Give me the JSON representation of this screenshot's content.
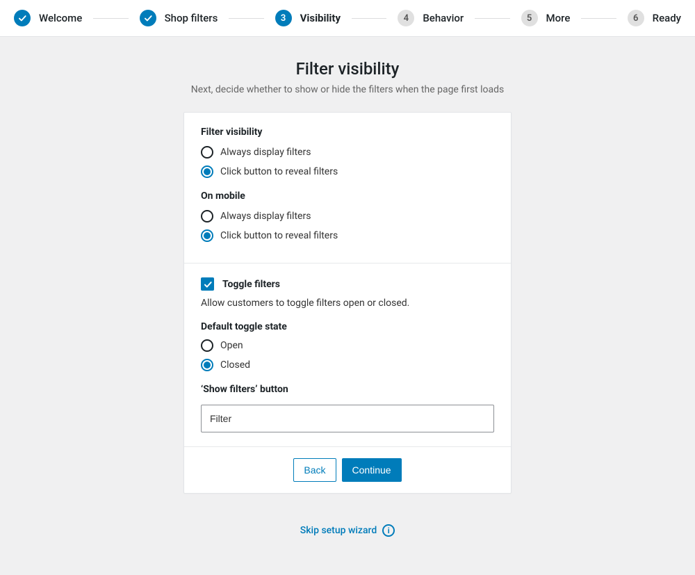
{
  "stepper": {
    "steps": [
      {
        "label": "Welcome",
        "state": "done",
        "index": "1"
      },
      {
        "label": "Shop filters",
        "state": "done",
        "index": "2"
      },
      {
        "label": "Visibility",
        "state": "active",
        "index": "3"
      },
      {
        "label": "Behavior",
        "state": "pending",
        "index": "4"
      },
      {
        "label": "More",
        "state": "pending",
        "index": "5"
      },
      {
        "label": "Ready",
        "state": "pending",
        "index": "6"
      }
    ]
  },
  "header": {
    "title": "Filter visibility",
    "subtitle": "Next, decide whether to show or hide the filters when the page first loads"
  },
  "section_visibility": {
    "heading": "Filter visibility",
    "options": [
      {
        "label": "Always display filters",
        "selected": false
      },
      {
        "label": "Click button to reveal filters",
        "selected": true
      }
    ],
    "mobile_heading": "On mobile",
    "mobile_options": [
      {
        "label": "Always display filters",
        "selected": false
      },
      {
        "label": "Click button to reveal filters",
        "selected": true
      }
    ]
  },
  "section_toggle": {
    "checkbox_label": "Toggle filters",
    "checkbox_checked": true,
    "description": "Allow customers to toggle filters open or closed.",
    "default_state_heading": "Default toggle state",
    "default_state_options": [
      {
        "label": "Open",
        "selected": false
      },
      {
        "label": "Closed",
        "selected": true
      }
    ],
    "show_button_heading": "‘Show filters’ button",
    "show_button_value": "Filter"
  },
  "footer": {
    "back_label": "Back",
    "continue_label": "Continue"
  },
  "skip": {
    "label": "Skip setup wizard",
    "info_glyph": "i"
  }
}
